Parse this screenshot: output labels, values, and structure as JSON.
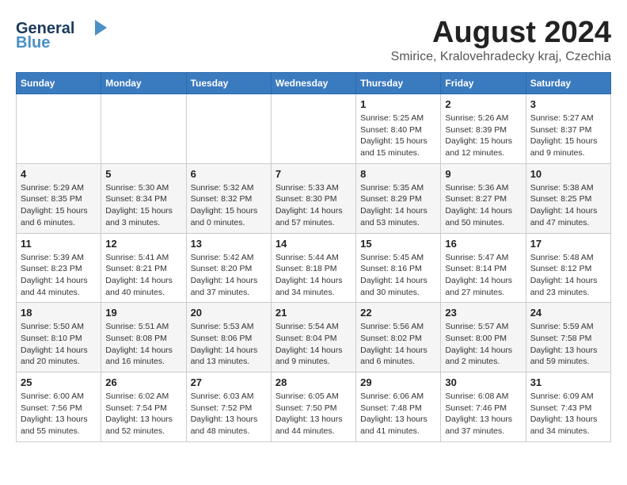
{
  "logo": {
    "general": "General",
    "blue": "Blue"
  },
  "title": "August 2024",
  "subtitle": "Smirice, Kralovehradecky kraj, Czechia",
  "headers": [
    "Sunday",
    "Monday",
    "Tuesday",
    "Wednesday",
    "Thursday",
    "Friday",
    "Saturday"
  ],
  "weeks": [
    [
      {
        "day": "",
        "detail": ""
      },
      {
        "day": "",
        "detail": ""
      },
      {
        "day": "",
        "detail": ""
      },
      {
        "day": "",
        "detail": ""
      },
      {
        "day": "1",
        "detail": "Sunrise: 5:25 AM\nSunset: 8:40 PM\nDaylight: 15 hours\nand 15 minutes."
      },
      {
        "day": "2",
        "detail": "Sunrise: 5:26 AM\nSunset: 8:39 PM\nDaylight: 15 hours\nand 12 minutes."
      },
      {
        "day": "3",
        "detail": "Sunrise: 5:27 AM\nSunset: 8:37 PM\nDaylight: 15 hours\nand 9 minutes."
      }
    ],
    [
      {
        "day": "4",
        "detail": "Sunrise: 5:29 AM\nSunset: 8:35 PM\nDaylight: 15 hours\nand 6 minutes."
      },
      {
        "day": "5",
        "detail": "Sunrise: 5:30 AM\nSunset: 8:34 PM\nDaylight: 15 hours\nand 3 minutes."
      },
      {
        "day": "6",
        "detail": "Sunrise: 5:32 AM\nSunset: 8:32 PM\nDaylight: 15 hours\nand 0 minutes."
      },
      {
        "day": "7",
        "detail": "Sunrise: 5:33 AM\nSunset: 8:30 PM\nDaylight: 14 hours\nand 57 minutes."
      },
      {
        "day": "8",
        "detail": "Sunrise: 5:35 AM\nSunset: 8:29 PM\nDaylight: 14 hours\nand 53 minutes."
      },
      {
        "day": "9",
        "detail": "Sunrise: 5:36 AM\nSunset: 8:27 PM\nDaylight: 14 hours\nand 50 minutes."
      },
      {
        "day": "10",
        "detail": "Sunrise: 5:38 AM\nSunset: 8:25 PM\nDaylight: 14 hours\nand 47 minutes."
      }
    ],
    [
      {
        "day": "11",
        "detail": "Sunrise: 5:39 AM\nSunset: 8:23 PM\nDaylight: 14 hours\nand 44 minutes."
      },
      {
        "day": "12",
        "detail": "Sunrise: 5:41 AM\nSunset: 8:21 PM\nDaylight: 14 hours\nand 40 minutes."
      },
      {
        "day": "13",
        "detail": "Sunrise: 5:42 AM\nSunset: 8:20 PM\nDaylight: 14 hours\nand 37 minutes."
      },
      {
        "day": "14",
        "detail": "Sunrise: 5:44 AM\nSunset: 8:18 PM\nDaylight: 14 hours\nand 34 minutes."
      },
      {
        "day": "15",
        "detail": "Sunrise: 5:45 AM\nSunset: 8:16 PM\nDaylight: 14 hours\nand 30 minutes."
      },
      {
        "day": "16",
        "detail": "Sunrise: 5:47 AM\nSunset: 8:14 PM\nDaylight: 14 hours\nand 27 minutes."
      },
      {
        "day": "17",
        "detail": "Sunrise: 5:48 AM\nSunset: 8:12 PM\nDaylight: 14 hours\nand 23 minutes."
      }
    ],
    [
      {
        "day": "18",
        "detail": "Sunrise: 5:50 AM\nSunset: 8:10 PM\nDaylight: 14 hours\nand 20 minutes."
      },
      {
        "day": "19",
        "detail": "Sunrise: 5:51 AM\nSunset: 8:08 PM\nDaylight: 14 hours\nand 16 minutes."
      },
      {
        "day": "20",
        "detail": "Sunrise: 5:53 AM\nSunset: 8:06 PM\nDaylight: 14 hours\nand 13 minutes."
      },
      {
        "day": "21",
        "detail": "Sunrise: 5:54 AM\nSunset: 8:04 PM\nDaylight: 14 hours\nand 9 minutes."
      },
      {
        "day": "22",
        "detail": "Sunrise: 5:56 AM\nSunset: 8:02 PM\nDaylight: 14 hours\nand 6 minutes."
      },
      {
        "day": "23",
        "detail": "Sunrise: 5:57 AM\nSunset: 8:00 PM\nDaylight: 14 hours\nand 2 minutes."
      },
      {
        "day": "24",
        "detail": "Sunrise: 5:59 AM\nSunset: 7:58 PM\nDaylight: 13 hours\nand 59 minutes."
      }
    ],
    [
      {
        "day": "25",
        "detail": "Sunrise: 6:00 AM\nSunset: 7:56 PM\nDaylight: 13 hours\nand 55 minutes."
      },
      {
        "day": "26",
        "detail": "Sunrise: 6:02 AM\nSunset: 7:54 PM\nDaylight: 13 hours\nand 52 minutes."
      },
      {
        "day": "27",
        "detail": "Sunrise: 6:03 AM\nSunset: 7:52 PM\nDaylight: 13 hours\nand 48 minutes."
      },
      {
        "day": "28",
        "detail": "Sunrise: 6:05 AM\nSunset: 7:50 PM\nDaylight: 13 hours\nand 44 minutes."
      },
      {
        "day": "29",
        "detail": "Sunrise: 6:06 AM\nSunset: 7:48 PM\nDaylight: 13 hours\nand 41 minutes."
      },
      {
        "day": "30",
        "detail": "Sunrise: 6:08 AM\nSunset: 7:46 PM\nDaylight: 13 hours\nand 37 minutes."
      },
      {
        "day": "31",
        "detail": "Sunrise: 6:09 AM\nSunset: 7:43 PM\nDaylight: 13 hours\nand 34 minutes."
      }
    ]
  ]
}
